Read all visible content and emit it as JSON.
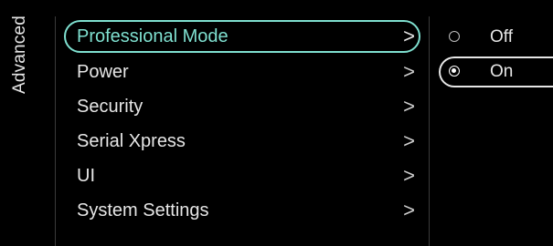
{
  "side_tab": {
    "label": "Advanced"
  },
  "menu": {
    "items": [
      {
        "label": "Professional Mode",
        "selected": true
      },
      {
        "label": "Power",
        "selected": false
      },
      {
        "label": "Security",
        "selected": false
      },
      {
        "label": "Serial Xpress",
        "selected": false
      },
      {
        "label": "UI",
        "selected": false
      },
      {
        "label": "System Settings",
        "selected": false
      }
    ],
    "chevron": ">"
  },
  "options": {
    "items": [
      {
        "label": "Off",
        "checked": false
      },
      {
        "label": "On",
        "checked": true
      }
    ]
  },
  "colors": {
    "background": "#000000",
    "accent": "#7fe0d0",
    "text": "#e6e6e6",
    "divider": "#3a3a3a"
  },
  "icons": {
    "chevron": "chevron-right-icon",
    "radio_unchecked": "radio-unchecked-icon",
    "radio_checked": "radio-checked-icon"
  }
}
